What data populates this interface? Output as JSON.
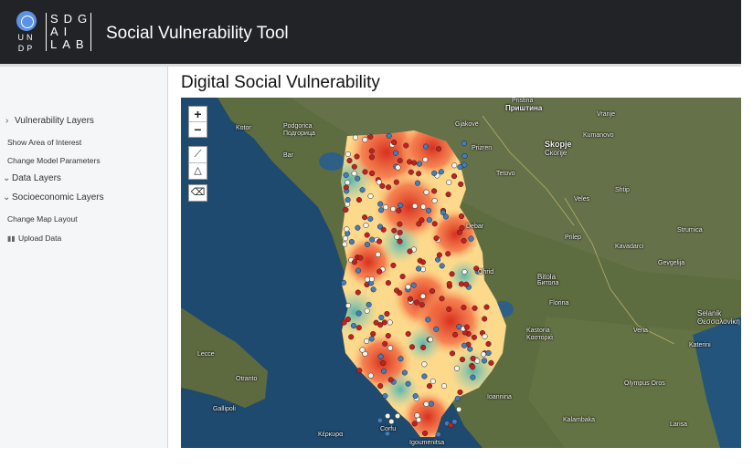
{
  "header": {
    "un_logo_text": "UN\nDP",
    "un_letters_row1": "UN",
    "un_letters_row2": "DP",
    "sdg_row1": "SDG",
    "sdg_row2": "AI",
    "sdg_row3": "LAB",
    "title": "Social Vulnerability Tool"
  },
  "sidebar": {
    "items": [
      {
        "label": "Vulnerability Layers",
        "icon": "chevron-right-icon"
      },
      {
        "label": "Show Area of Interest"
      },
      {
        "label": "Change Model Parameters"
      },
      {
        "label": "Data Layers",
        "icon": "chevron-down-icon"
      },
      {
        "label": "Socioeconomic Layers",
        "icon": "chevron-down-icon"
      },
      {
        "label": "Change Map Layout"
      },
      {
        "label": "Upload Data",
        "icon": "bar-chart-icon"
      }
    ]
  },
  "main": {
    "title": "Digital Social Vulnerability"
  },
  "map": {
    "zoom_in": "+",
    "zoom_out": "−",
    "tools": [
      "ruler-icon",
      "polygon-icon",
      "eraser-icon"
    ],
    "labels": {
      "pristina": "Pristina",
      "pristina_cyr": "Приштина",
      "podgorica": "Podgorica",
      "podgorica_cyr": "Подгорица",
      "skopje": "Skopje",
      "skopje_cyr": "Скопје",
      "prizren": "Prizren",
      "gjakove": "Gjakovë",
      "vranje": "Vranje",
      "kumanovo": "Kumanovo",
      "tetovo": "Tetovo",
      "veles": "Veles",
      "shtip": "Shtip",
      "debar": "Debar",
      "ohrid": "Ohrid",
      "bitola": "Bitola",
      "bitola_cyr": "Битола",
      "prilep": "Prilep",
      "kavadarci": "Kavadarci",
      "strumica": "Strumica",
      "gevgelija": "Gevgelija",
      "florina": "Florina",
      "kastoria": "Kastoria",
      "kastoria_gr": "Καστοριά",
      "veria": "Veria",
      "katerini": "Katerini",
      "olympus": "Olympus Oros",
      "thessaloniki": "Selanik",
      "thessaloniki_gr": "Θεσσαλονίκη",
      "ioannina": "Ioannina",
      "kalambaka": "Kalambaka",
      "larissa": "Larisa",
      "corfu": "Corfu",
      "corfu_gr": "Κέρκυρα",
      "igoumenitsa": "Igoumenitsa",
      "lecce": "Lecce",
      "otranto": "Otranto",
      "gallipoli": "Gallipoli",
      "kotor": "Kotor",
      "bar": "Bar"
    }
  },
  "colors": {
    "header_bg": "#222327",
    "un_blue": "#5b92e5",
    "sidebar_bg": "#f4f6f8",
    "sea": "#1f4f73",
    "land": "#5a6b3e",
    "heat_high": "#d7301f",
    "heat_mid": "#fee090",
    "heat_low": "#91cfb5",
    "point_red": "#c81e1e",
    "point_blue": "#3f7fbf",
    "point_white": "#f4f4e8"
  }
}
